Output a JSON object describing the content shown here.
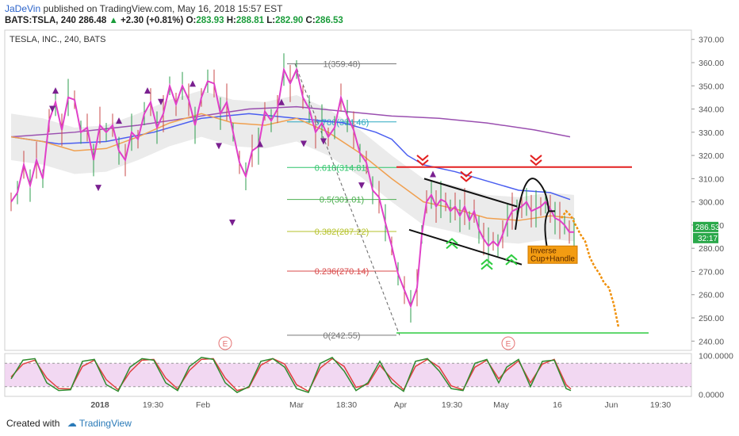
{
  "header": {
    "author": "JaDeVin",
    "published": "published on TradingView.com, May 16, 2018 15:57 EST",
    "symbol": "BATS:TSLA, 240",
    "last": "286.48",
    "change": "+2.30 (+0.81%)",
    "o_label": "O:",
    "o": "283.93",
    "h_label": "H:",
    "h": "288.81",
    "l_label": "L:",
    "l": "282.90",
    "c_label": "C:",
    "c": "286.53"
  },
  "chart_title": "TESLA, INC., 240, BATS",
  "footer": {
    "created_with": "Created with",
    "brand": "TradingView"
  },
  "colors": {
    "price_line": "#e040c8",
    "orange_ma": "#f0a050",
    "blue_ma": "#4a5ef0",
    "purple_ma": "#9a4fb0",
    "resistance": "#e32020",
    "support": "#2ecc40",
    "projection": "#f0900a",
    "stoch_k": "#2e8b2e",
    "stoch_d": "#e04040",
    "stoch_band": "#ecc8ec"
  },
  "fib_levels": [
    {
      "label": "1(359.48)",
      "value": 359.48,
      "color": "#777777"
    },
    {
      "label": "0.786(334.46)",
      "value": 334.46,
      "color": "#2aa8c0"
    },
    {
      "label": "0.618(314.81)",
      "value": 314.81,
      "color": "#2ec46a"
    },
    {
      "label": "0.5(301.01)",
      "value": 301.01,
      "color": "#4caf50"
    },
    {
      "label": "0.382(287.22)",
      "value": 287.22,
      "color": "#b5c22a"
    },
    {
      "label": "0.236(270.14)",
      "value": 270.14,
      "color": "#d84848"
    },
    {
      "label": "0(242.55)",
      "value": 242.55,
      "color": "#777777"
    }
  ],
  "annotation": {
    "text1": "Inverse",
    "text2": "Cup+Handle"
  },
  "price_badges": {
    "current": "286.53",
    "countdown": "32:17"
  },
  "events": [
    "E",
    "E"
  ],
  "chart_data": {
    "type": "line",
    "title": "TESLA, INC., 240, BATS",
    "y_axis_ticks": [
      370,
      360,
      350,
      340,
      330,
      320,
      310,
      300,
      290,
      280,
      270,
      260,
      250,
      240
    ],
    "y_axis_labels": [
      "370.00",
      "360.00",
      "350.00",
      "340.00",
      "330.00",
      "320.00",
      "310.00",
      "300.00",
      "290.00",
      "280.00",
      "270.00",
      "260.00",
      "250.00",
      "240.00"
    ],
    "ylim": [
      236,
      374
    ],
    "x_axis_labels": [
      "2018",
      "19:30",
      "Feb",
      "Mar",
      "18:30",
      "Apr",
      "19:30",
      "May",
      "16",
      "Jun",
      "19:30"
    ],
    "series": [
      {
        "name": "",
        "points": [
          [
            0,
            300
          ],
          [
            8,
            304
          ],
          [
            16,
            316
          ],
          [
            24,
            307
          ],
          [
            32,
            318
          ],
          [
            40,
            310
          ],
          [
            48,
            335
          ],
          [
            56,
            343
          ],
          [
            64,
            331
          ],
          [
            72,
            345
          ],
          [
            80,
            344
          ],
          [
            88,
            330
          ],
          [
            96,
            332
          ],
          [
            104,
            318
          ],
          [
            112,
            333
          ],
          [
            120,
            330
          ],
          [
            128,
            333
          ],
          [
            136,
            322
          ],
          [
            144,
            318
          ],
          [
            152,
            330
          ],
          [
            160,
            327
          ],
          [
            168,
            338
          ],
          [
            176,
            343
          ],
          [
            184,
            332
          ],
          [
            192,
            338
          ],
          [
            200,
            350
          ],
          [
            208,
            342
          ],
          [
            216,
            350
          ],
          [
            224,
            344
          ],
          [
            232,
            333
          ],
          [
            240,
            345
          ],
          [
            248,
            352
          ],
          [
            256,
            351
          ],
          [
            264,
            338
          ],
          [
            272,
            343
          ],
          [
            280,
            330
          ],
          [
            288,
            317
          ],
          [
            296,
            311
          ],
          [
            304,
            322
          ],
          [
            312,
            324
          ],
          [
            320,
            339
          ],
          [
            328,
            335
          ],
          [
            336,
            340
          ],
          [
            344,
            357
          ],
          [
            352,
            351
          ],
          [
            360,
            357
          ],
          [
            368,
            345
          ],
          [
            376,
            340
          ],
          [
            384,
            330
          ],
          [
            392,
            334
          ],
          [
            400,
            328
          ],
          [
            408,
            332
          ],
          [
            416,
            345
          ],
          [
            424,
            337
          ],
          [
            432,
            331
          ],
          [
            440,
            321
          ],
          [
            448,
            317
          ],
          [
            456,
            305
          ],
          [
            464,
            302
          ],
          [
            472,
            291
          ],
          [
            480,
            281
          ],
          [
            488,
            269
          ],
          [
            496,
            262
          ],
          [
            504,
            255
          ],
          [
            512,
            263
          ],
          [
            518,
            286
          ],
          [
            524,
            300
          ],
          [
            530,
            303
          ],
          [
            536,
            298
          ],
          [
            542,
            301
          ],
          [
            548,
            300
          ],
          [
            554,
            296
          ],
          [
            560,
            298
          ],
          [
            566,
            294
          ],
          [
            572,
            298
          ],
          [
            578,
            292
          ],
          [
            584,
            296
          ],
          [
            590,
            288
          ],
          [
            596,
            284
          ],
          [
            602,
            281
          ],
          [
            608,
            283
          ],
          [
            614,
            281
          ],
          [
            620,
            286
          ],
          [
            626,
            292
          ],
          [
            632,
            296
          ],
          [
            638,
            297
          ],
          [
            644,
            298
          ],
          [
            650,
            300
          ],
          [
            656,
            296
          ],
          [
            662,
            297
          ],
          [
            668,
            298
          ],
          [
            674,
            300
          ],
          [
            680,
            297
          ],
          [
            686,
            293
          ],
          [
            692,
            292
          ],
          [
            698,
            290
          ],
          [
            704,
            287
          ],
          [
            710,
            287
          ]
        ]
      },
      {
        "name": "",
        "points": [
          [
            0,
            328
          ],
          [
            40,
            326
          ],
          [
            80,
            322
          ],
          [
            120,
            323
          ],
          [
            160,
            328
          ],
          [
            200,
            334
          ],
          [
            240,
            338
          ],
          [
            280,
            334
          ],
          [
            320,
            333
          ],
          [
            360,
            336
          ],
          [
            400,
            330
          ],
          [
            440,
            321
          ],
          [
            480,
            310
          ],
          [
            520,
            300
          ],
          [
            560,
            297
          ],
          [
            600,
            293
          ],
          [
            640,
            292
          ],
          [
            680,
            294
          ],
          [
            710,
            293
          ]
        ]
      },
      {
        "name": "",
        "points": [
          [
            0,
            328
          ],
          [
            60,
            325
          ],
          [
            120,
            326
          ],
          [
            180,
            330
          ],
          [
            240,
            336
          ],
          [
            300,
            338
          ],
          [
            360,
            336
          ],
          [
            420,
            334
          ],
          [
            460,
            330
          ],
          [
            480,
            327
          ],
          [
            500,
            320
          ],
          [
            520,
            316
          ],
          [
            560,
            313
          ],
          [
            600,
            309
          ],
          [
            640,
            305
          ],
          [
            680,
            304
          ],
          [
            705,
            301
          ]
        ]
      },
      {
        "name": "",
        "points": [
          [
            0,
            328
          ],
          [
            80,
            330
          ],
          [
            160,
            333
          ],
          [
            240,
            337
          ],
          [
            300,
            340
          ],
          [
            360,
            341
          ],
          [
            420,
            339
          ],
          [
            480,
            337
          ],
          [
            540,
            336
          ],
          [
            600,
            334
          ],
          [
            660,
            331
          ],
          [
            705,
            328
          ]
        ]
      }
    ],
    "projection": [
      [
        694,
        293
      ],
      [
        700,
        296
      ],
      [
        706,
        294
      ],
      [
        712,
        290
      ],
      [
        718,
        286
      ],
      [
        724,
        283
      ],
      [
        730,
        276
      ],
      [
        736,
        272
      ],
      [
        742,
        269
      ],
      [
        748,
        265
      ],
      [
        754,
        263
      ],
      [
        760,
        256
      ],
      [
        766,
        246
      ]
    ],
    "lines": {
      "resistance": 315,
      "support": 243.5
    },
    "stochastic": {
      "ylim": [
        -5,
        105
      ],
      "ticks": [
        100,
        0
      ],
      "tick_labels": [
        "100.0000",
        "0.0000"
      ],
      "upper_band": 80,
      "lower_band": 20,
      "k": [
        [
          0,
          40
        ],
        [
          15,
          88
        ],
        [
          30,
          92
        ],
        [
          45,
          30
        ],
        [
          60,
          10
        ],
        [
          75,
          12
        ],
        [
          90,
          85
        ],
        [
          105,
          90
        ],
        [
          120,
          25
        ],
        [
          135,
          8
        ],
        [
          150,
          70
        ],
        [
          165,
          92
        ],
        [
          180,
          88
        ],
        [
          195,
          30
        ],
        [
          210,
          10
        ],
        [
          225,
          72
        ],
        [
          240,
          95
        ],
        [
          255,
          90
        ],
        [
          270,
          30
        ],
        [
          285,
          5
        ],
        [
          300,
          20
        ],
        [
          315,
          85
        ],
        [
          330,
          92
        ],
        [
          345,
          70
        ],
        [
          360,
          15
        ],
        [
          375,
          5
        ],
        [
          390,
          80
        ],
        [
          405,
          95
        ],
        [
          420,
          60
        ],
        [
          435,
          10
        ],
        [
          450,
          30
        ],
        [
          465,
          85
        ],
        [
          480,
          30
        ],
        [
          495,
          8
        ],
        [
          510,
          85
        ],
        [
          525,
          92
        ],
        [
          540,
          60
        ],
        [
          555,
          15
        ],
        [
          570,
          10
        ],
        [
          585,
          80
        ],
        [
          600,
          90
        ],
        [
          615,
          30
        ],
        [
          625,
          70
        ],
        [
          640,
          90
        ],
        [
          655,
          20
        ],
        [
          670,
          85
        ],
        [
          685,
          88
        ],
        [
          700,
          15
        ],
        [
          706,
          10
        ]
      ],
      "d": [
        [
          0,
          45
        ],
        [
          15,
          78
        ],
        [
          30,
          88
        ],
        [
          45,
          42
        ],
        [
          60,
          15
        ],
        [
          75,
          14
        ],
        [
          90,
          72
        ],
        [
          105,
          88
        ],
        [
          120,
          38
        ],
        [
          135,
          12
        ],
        [
          150,
          58
        ],
        [
          165,
          88
        ],
        [
          180,
          90
        ],
        [
          195,
          42
        ],
        [
          210,
          14
        ],
        [
          225,
          62
        ],
        [
          240,
          90
        ],
        [
          255,
          92
        ],
        [
          270,
          42
        ],
        [
          285,
          10
        ],
        [
          300,
          18
        ],
        [
          315,
          75
        ],
        [
          330,
          92
        ],
        [
          345,
          78
        ],
        [
          360,
          25
        ],
        [
          375,
          8
        ],
        [
          390,
          68
        ],
        [
          405,
          92
        ],
        [
          420,
          72
        ],
        [
          435,
          18
        ],
        [
          450,
          26
        ],
        [
          465,
          75
        ],
        [
          480,
          40
        ],
        [
          495,
          12
        ],
        [
          510,
          72
        ],
        [
          525,
          90
        ],
        [
          540,
          70
        ],
        [
          555,
          22
        ],
        [
          570,
          12
        ],
        [
          585,
          70
        ],
        [
          600,
          88
        ],
        [
          615,
          40
        ],
        [
          625,
          62
        ],
        [
          640,
          86
        ],
        [
          655,
          30
        ],
        [
          670,
          78
        ],
        [
          685,
          90
        ],
        [
          700,
          25
        ],
        [
          706,
          14
        ]
      ]
    }
  }
}
